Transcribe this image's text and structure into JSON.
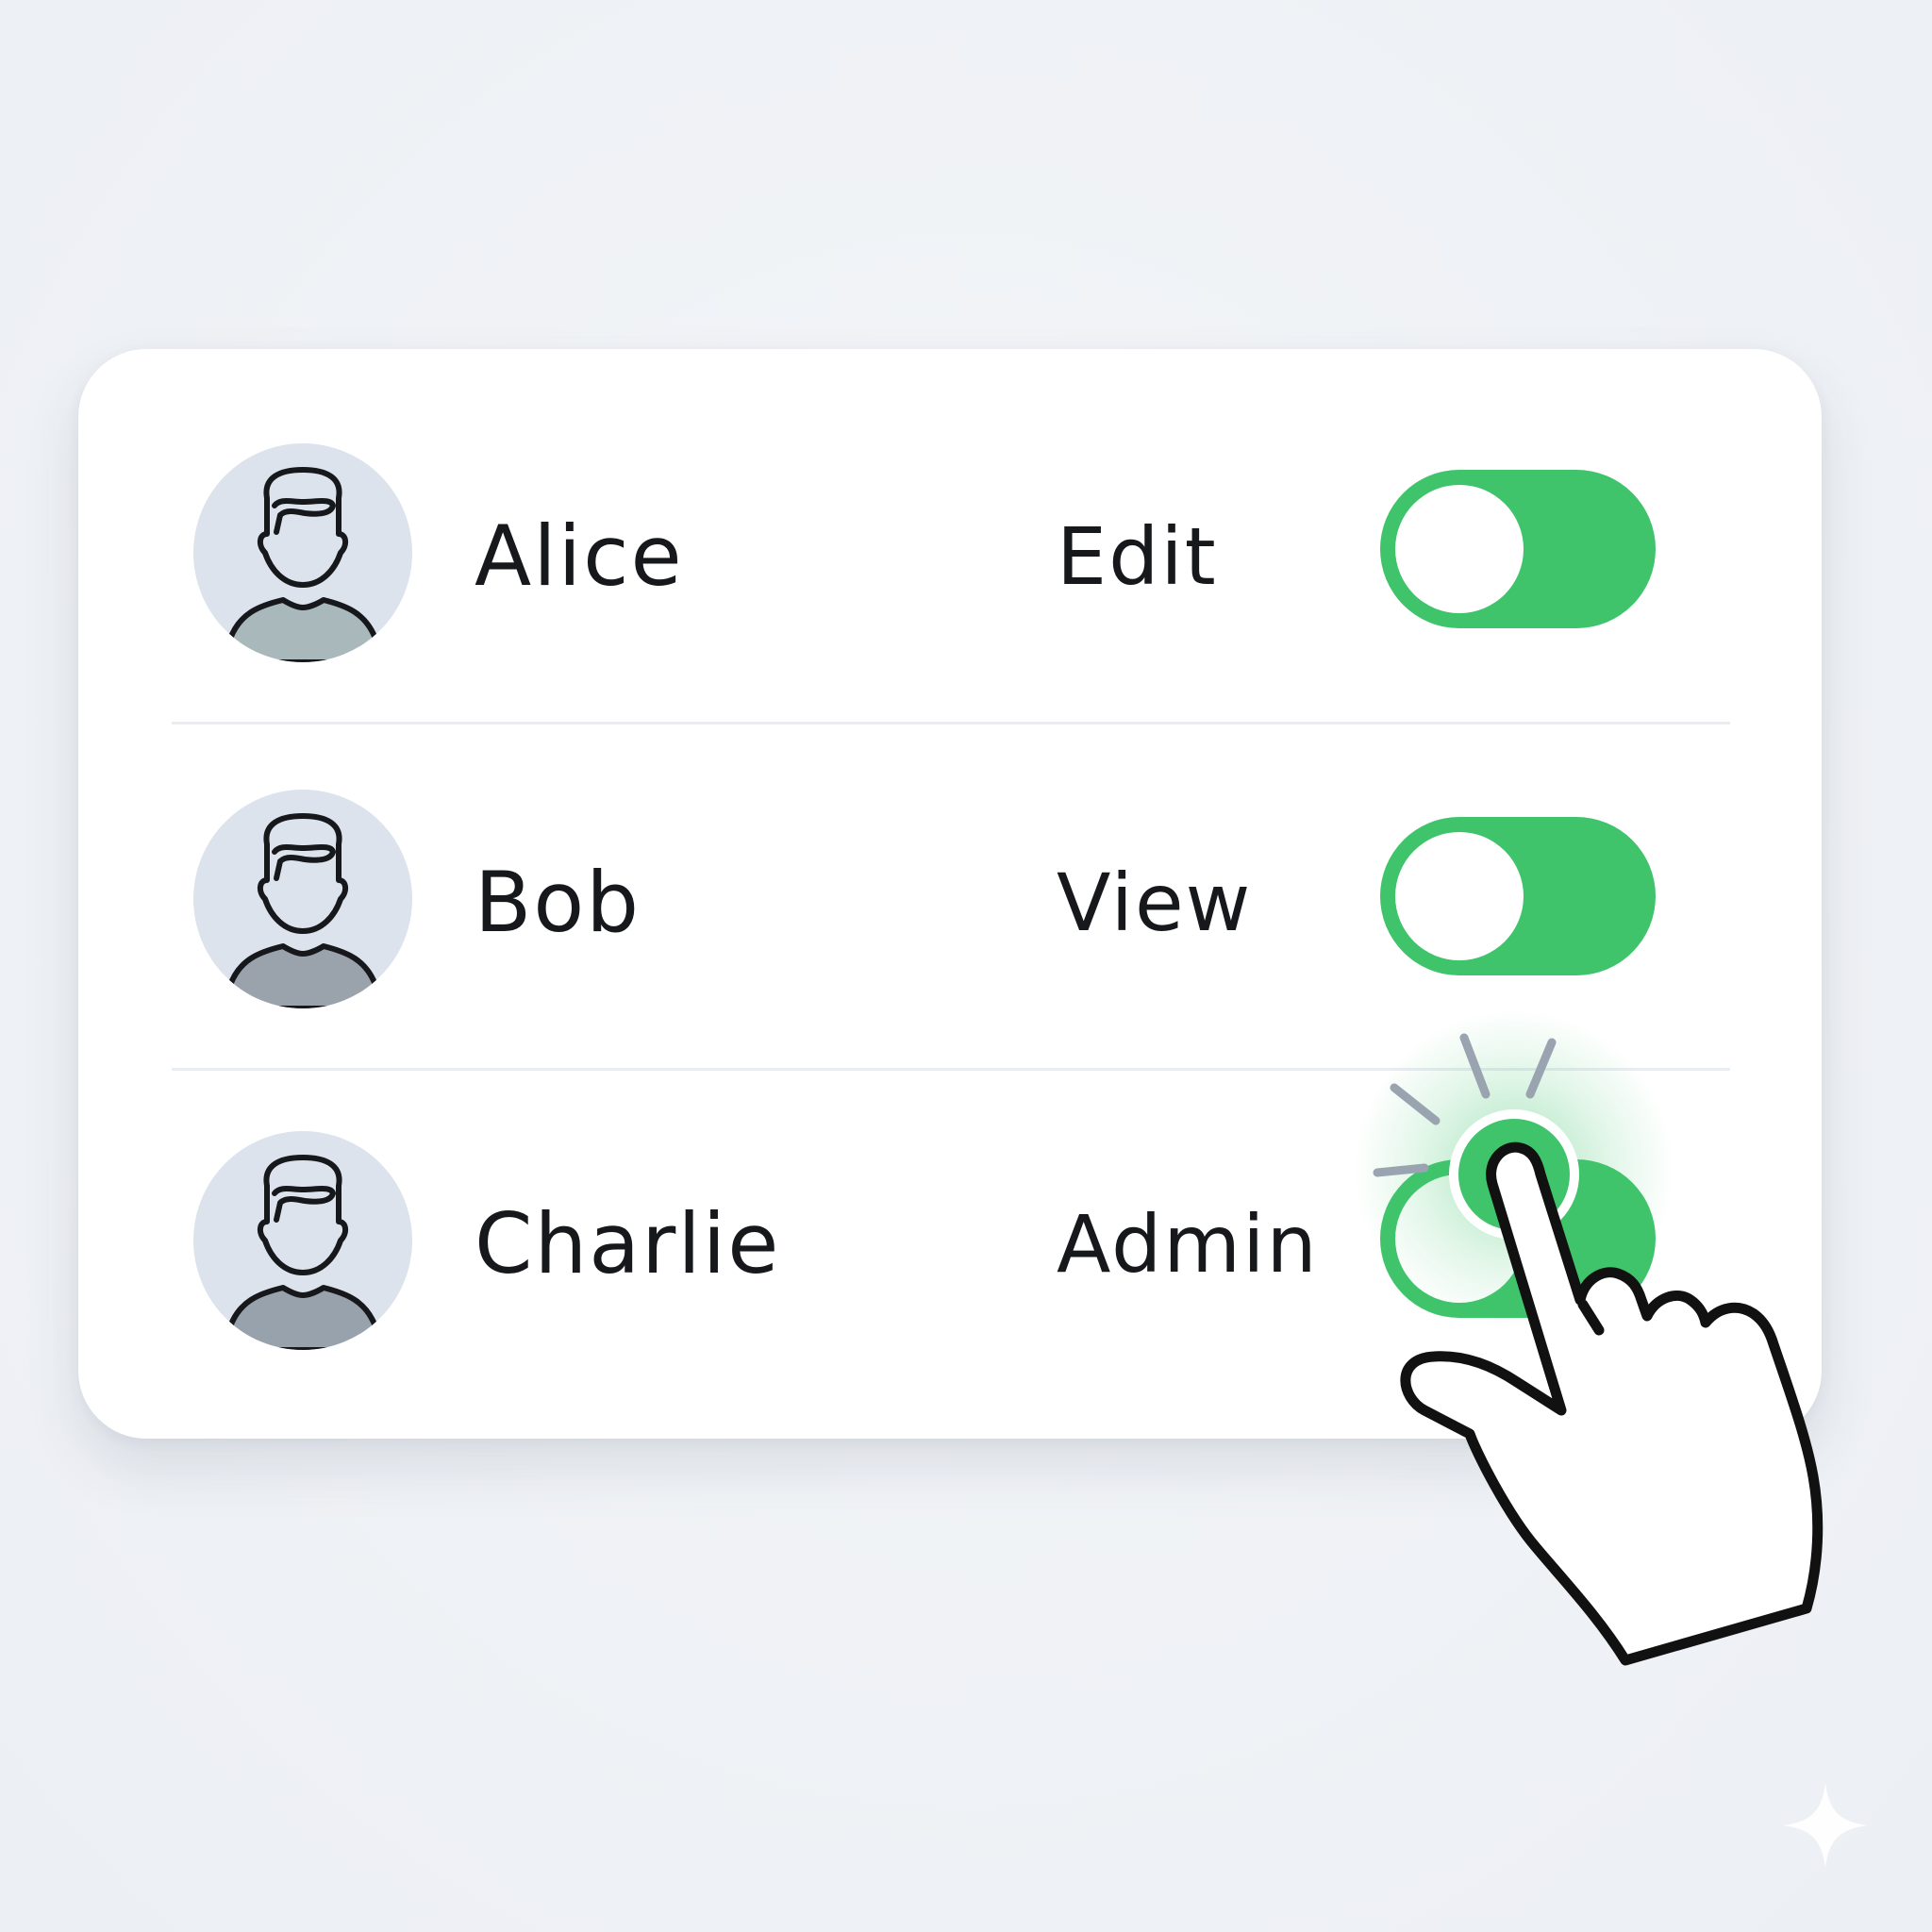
{
  "users": [
    {
      "name": "Alice",
      "role": "Edit",
      "toggle_on": true
    },
    {
      "name": "Bob",
      "role": "View",
      "toggle_on": true
    },
    {
      "name": "Charlie",
      "role": "Admin",
      "toggle_on": true
    }
  ],
  "colors": {
    "toggle_on": "#3fc46b",
    "avatar_bg": "#dde3ec",
    "text": "#16181c",
    "background": "#eff2f6"
  },
  "icons": {
    "avatar": "user-avatar-icon",
    "pointer": "hand-pointer-icon",
    "sparkle": "sparkle-icon"
  }
}
